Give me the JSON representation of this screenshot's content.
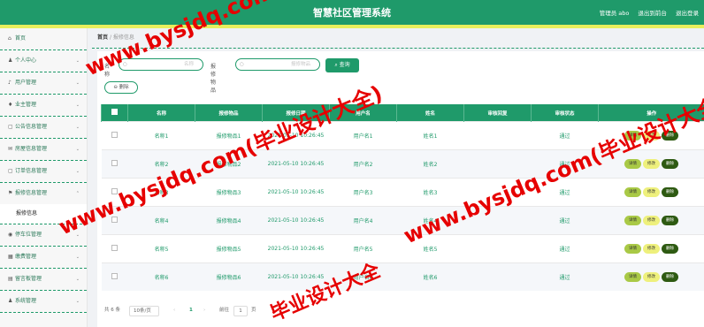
{
  "header": {
    "title": "智慧社区管理系统",
    "admin": "管理员 abo",
    "back": "退出到前台",
    "logout": "退出登录"
  },
  "sidebar": {
    "items": [
      {
        "label": "首页",
        "icon": "home-icon",
        "glyph": "⌂",
        "chev": ""
      },
      {
        "label": "个人中心",
        "icon": "person-icon",
        "glyph": "♟",
        "chev": "⌄"
      },
      {
        "label": "用户管理",
        "icon": "mic-icon",
        "glyph": "♪",
        "chev": "⌄"
      },
      {
        "label": "业主管理",
        "icon": "pin-icon",
        "glyph": "♦",
        "chev": "⌄"
      },
      {
        "label": "公告信息管理",
        "icon": "doc-icon",
        "glyph": "▢",
        "chev": "⌄"
      },
      {
        "label": "房屋信息管理",
        "icon": "mail-icon",
        "glyph": "✉",
        "chev": "⌄"
      },
      {
        "label": "订单信息管理",
        "icon": "doc-icon",
        "glyph": "▢",
        "chev": "⌄"
      },
      {
        "label": "报修信息管理",
        "icon": "flag-icon",
        "glyph": "⚑",
        "chev": "⌃"
      },
      {
        "label": "报修信息",
        "sub": true
      },
      {
        "label": "停车位管理",
        "icon": "location-icon",
        "glyph": "◉",
        "chev": "⌄"
      },
      {
        "label": "缴费管理",
        "icon": "grid-icon",
        "glyph": "▦",
        "chev": "⌄"
      },
      {
        "label": "留言板管理",
        "icon": "board-icon",
        "glyph": "▤",
        "chev": "⌄"
      },
      {
        "label": "系统管理",
        "icon": "user-icon",
        "glyph": "♟",
        "chev": "⌄"
      }
    ]
  },
  "breadcrumb": {
    "home": "首页",
    "sep": "/",
    "current": "报修信息"
  },
  "search": {
    "name_label": "名称",
    "name_placeholder": "名称",
    "item_label": "报修物品",
    "item_placeholder": "报修物品",
    "search_button": "查询",
    "delete_button": "删除"
  },
  "table": {
    "headers": [
      "",
      "名称",
      "报修物品",
      "报修日期",
      "用户名",
      "姓名",
      "审核回复",
      "审核状态",
      "操作"
    ],
    "rows": [
      {
        "name": "名称1",
        "item": "报修物品1",
        "date": "2021-05-10 10:26:45",
        "user": "用户名1",
        "real": "姓名1",
        "reply": "",
        "status": "通过"
      },
      {
        "name": "名称2",
        "item": "报修物品2",
        "date": "2021-05-10 10:26:45",
        "user": "用户名2",
        "real": "姓名2",
        "reply": "",
        "status": "通过"
      },
      {
        "name": "名称3",
        "item": "报修物品3",
        "date": "2021-05-10 10:26:45",
        "user": "用户名3",
        "real": "姓名3",
        "reply": "",
        "status": "通过"
      },
      {
        "name": "名称4",
        "item": "报修物品4",
        "date": "2021-05-10 10:26:45",
        "user": "用户名4",
        "real": "姓名4",
        "reply": "",
        "status": "通过"
      },
      {
        "name": "名称5",
        "item": "报修物品5",
        "date": "2021-05-10 10:26:45",
        "user": "用户名5",
        "real": "姓名5",
        "reply": "",
        "status": "通过"
      },
      {
        "name": "名称6",
        "item": "报修物品6",
        "date": "2021-05-10 10:26:45",
        "user": "用户名6",
        "real": "姓名6",
        "reply": "",
        "status": "通过"
      }
    ],
    "op_view": "详情",
    "op_edit": "修改",
    "op_delete": "删除"
  },
  "pager": {
    "total": "共 6 条",
    "size": "10条/页",
    "prev": "‹",
    "page": "1",
    "next": "›",
    "goto": "前往",
    "goto_value": "1",
    "page_unit": "页"
  },
  "watermark": {
    "text1": "www.bysjdq.com(毕业设计大全)",
    "text2": "www.bysjdq.com(毕业设计大全)",
    "text3": "www.bysjdq.com(毕业设计大全)",
    "text4": "毕业设计大全"
  },
  "colors": {
    "primary": "#1f9a6a",
    "accent_bar": "#e8ef5c",
    "watermark": "#e60000"
  }
}
